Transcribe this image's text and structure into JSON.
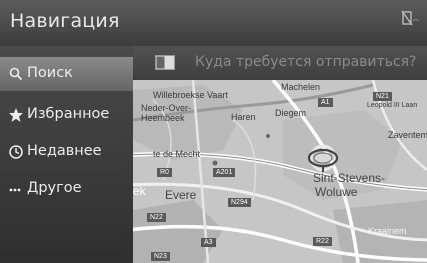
{
  "header": {
    "title": "Навигация"
  },
  "sidebar": {
    "items": [
      {
        "label": "Поиск",
        "icon": "search-icon",
        "active": true
      },
      {
        "label": "Избранное",
        "icon": "star-icon",
        "active": false
      },
      {
        "label": "Недавнее",
        "icon": "clock-icon",
        "active": false
      },
      {
        "label": "Другое",
        "icon": "more-icon",
        "active": false
      }
    ]
  },
  "search": {
    "placeholder": "Куда требуется отправиться?"
  },
  "map": {
    "places": {
      "willebroekse": "Willebroekse Vaart",
      "neder": "Neder-Over-",
      "heembeek": "Heembeek",
      "haren": "Haren",
      "diegem": "Diegem",
      "machelen": "Machelen",
      "leopold": "Leopold III Laan",
      "zaventem": "Zaventem",
      "sint1": "Sint-Stevens-",
      "sint2": "Woluwe",
      "eyere": "Evere",
      "bek": "ek",
      "kraainem": "Kraainem",
      "mecht": "te de Mecht"
    },
    "roads": {
      "a1": "A1",
      "a201": "A201",
      "r0": "R0",
      "n294": "N294",
      "n22": "N22",
      "a3": "A3",
      "r22": "R22",
      "n23": "N23",
      "n21": "N21"
    }
  }
}
